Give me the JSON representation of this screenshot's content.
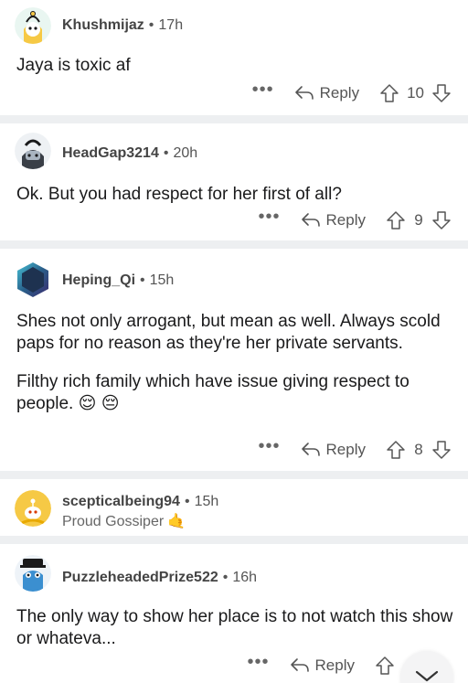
{
  "comments": [
    {
      "author": "Khushmijaz",
      "separator": "•",
      "time": "17h",
      "paragraphs": [
        "Jaya is toxic af"
      ],
      "more": "•••",
      "reply_label": "Reply",
      "score": "10"
    },
    {
      "author": "HeadGap3214",
      "separator": "•",
      "time": "20h",
      "paragraphs": [
        "Ok. But you had respect for her first of all?"
      ],
      "more": "•••",
      "reply_label": "Reply",
      "score": "9"
    },
    {
      "author": "Heping_Qi",
      "separator": "•",
      "time": "15h",
      "paragraphs": [
        "Shes not only arrogant, but mean as well. Always scold paps for no reason as they're her private servants.",
        "Filthy rich family which have issue giving respect to people. 😌 😔"
      ],
      "more": "•••",
      "reply_label": "Reply",
      "score": "8"
    },
    {
      "author": "scepticalbeing94",
      "separator": "•",
      "time": "15h",
      "flair": "Proud Gossiper",
      "flair_emoji": "🤙"
    },
    {
      "author": "PuzzleheadedPrize522",
      "separator": "•",
      "time": "16h",
      "paragraphs": [
        "The only way to show her place is to not watch this show or whateva..."
      ],
      "more": "•••",
      "reply_label": "Reply",
      "score": ""
    }
  ],
  "icons": {
    "reply": "reply-arrow-icon",
    "upvote": "upvote-arrow-icon",
    "downvote": "downvote-arrow-icon",
    "scroll": "chevron-down-icon"
  },
  "colors": {
    "separator": "#edeff1",
    "text": "#1a1a1b",
    "meta": "#555555",
    "snoo_yellow": "#f6c945"
  }
}
